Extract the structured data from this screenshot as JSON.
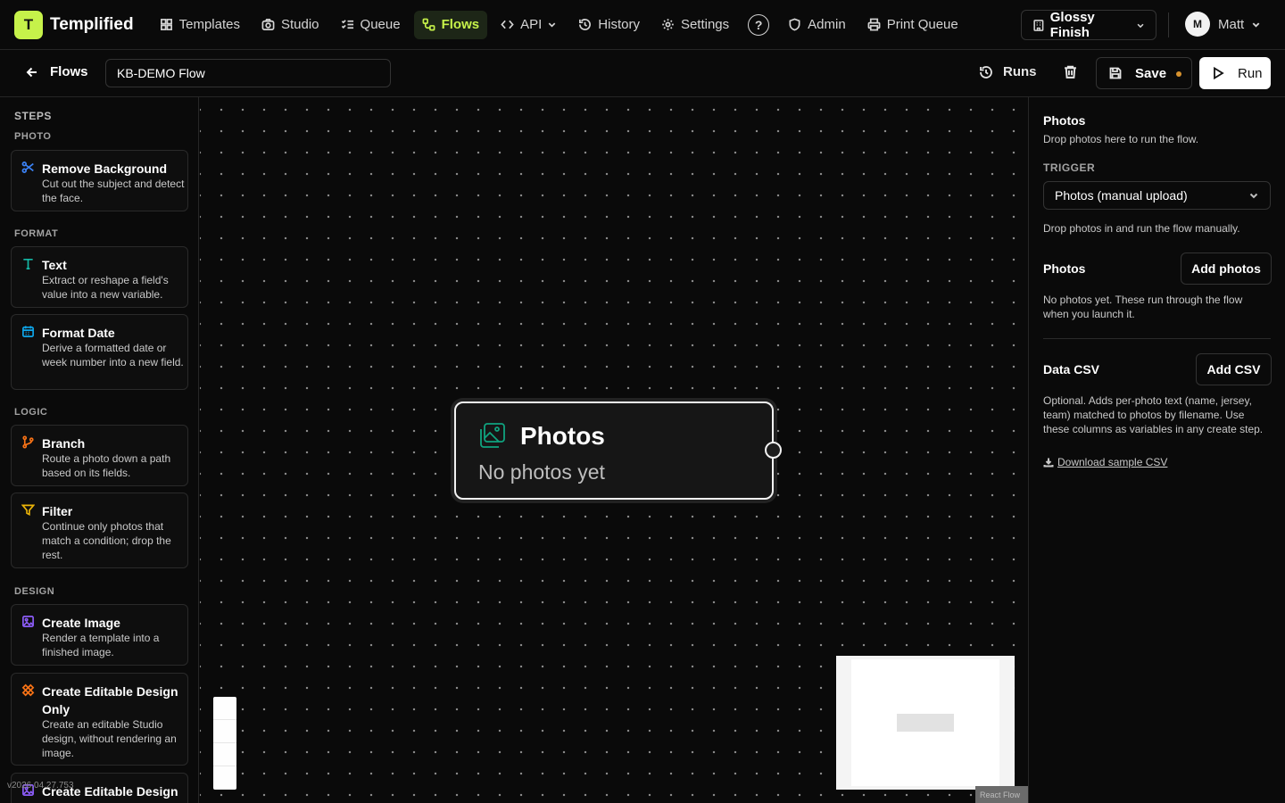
{
  "brand": {
    "logo_letter": "T",
    "name": "Templified",
    "accent": "#c6f24a"
  },
  "nav": {
    "items": [
      {
        "label": "Templates",
        "icon": "grid-icon"
      },
      {
        "label": "Studio",
        "icon": "camera-icon"
      },
      {
        "label": "Queue",
        "icon": "list-check-icon"
      },
      {
        "label": "Flows",
        "icon": "workflow-icon",
        "active": true
      },
      {
        "label": "API",
        "icon": "code-icon"
      },
      {
        "label": "History",
        "icon": "history-icon"
      },
      {
        "label": "Settings",
        "icon": "gear-icon"
      },
      {
        "label": "Admin",
        "icon": "shield-icon"
      },
      {
        "label": "Print Queue",
        "icon": "printer-icon"
      }
    ],
    "help_symbol": "?",
    "workspace": "Glossy Finish",
    "user": {
      "initial": "M",
      "name": "Matt"
    }
  },
  "subbar": {
    "back_label": "Flows",
    "flow_name": "KB-DEMO Flow",
    "runs_label": "Runs",
    "save_label": "Save",
    "run_label": "Run",
    "unsaved_color": "#d7922e"
  },
  "sidebar": {
    "title": "STEPS",
    "sections": {
      "photo": "PHOTO",
      "format": "FORMAT",
      "logic": "LOGIC",
      "design": "DESIGN"
    },
    "steps": {
      "remove_background": {
        "title": "Remove Background",
        "desc": "Cut out the subject and detect the face.",
        "icon": "scissors-icon",
        "color": "#3b82f6"
      },
      "text": {
        "title": "Text",
        "desc": "Extract or reshape a field's value into a new variable.",
        "icon": "text-icon",
        "color": "#14b8a6"
      },
      "format_date": {
        "title": "Format Date",
        "desc": "Derive a formatted date or week number into a new field.",
        "icon": "calendar-icon",
        "color": "#0ea5e9"
      },
      "branch": {
        "title": "Branch",
        "desc": "Route a photo down a path based on its fields.",
        "icon": "branch-icon",
        "color": "#f97316"
      },
      "filter": {
        "title": "Filter",
        "desc": "Continue only photos that match a condition; drop the rest.",
        "icon": "filter-icon",
        "color": "#eab308"
      },
      "create_image": {
        "title": "Create Image",
        "desc": "Render a template into a finished image.",
        "icon": "image-icon",
        "color": "#8b5cf6"
      },
      "create_editable": {
        "title": "Create Editable Design Only",
        "desc": "Create an editable Studio design, without rendering an image.",
        "icon": "design-icon",
        "color": "#f97316"
      },
      "create_editable_render": {
        "title": "Create Editable Design",
        "icon": "design-render-icon",
        "color": "#8b5cf6"
      }
    },
    "version": "v2026.04.27.753"
  },
  "canvas": {
    "node": {
      "title": "Photos",
      "subtitle": "No photos yet",
      "icon": "images-icon",
      "icon_color": "#10a37f"
    },
    "attribution": "React Flow"
  },
  "panel": {
    "title": "Photos",
    "subtitle": "Drop photos here to run the flow.",
    "trigger_label": "TRIGGER",
    "trigger_value": "Photos (manual upload)",
    "trigger_help": "Drop photos in and run the flow manually.",
    "photos_label": "Photos",
    "add_photos": "Add photos",
    "photos_help": "No photos yet. These run through the flow when you launch it.",
    "csv_label": "Data CSV",
    "add_csv": "Add CSV",
    "csv_help": "Optional. Adds per-photo text (name, jersey, team) matched to photos by filename. Use these columns as variables in any create step.",
    "download_link": "Download sample CSV"
  }
}
